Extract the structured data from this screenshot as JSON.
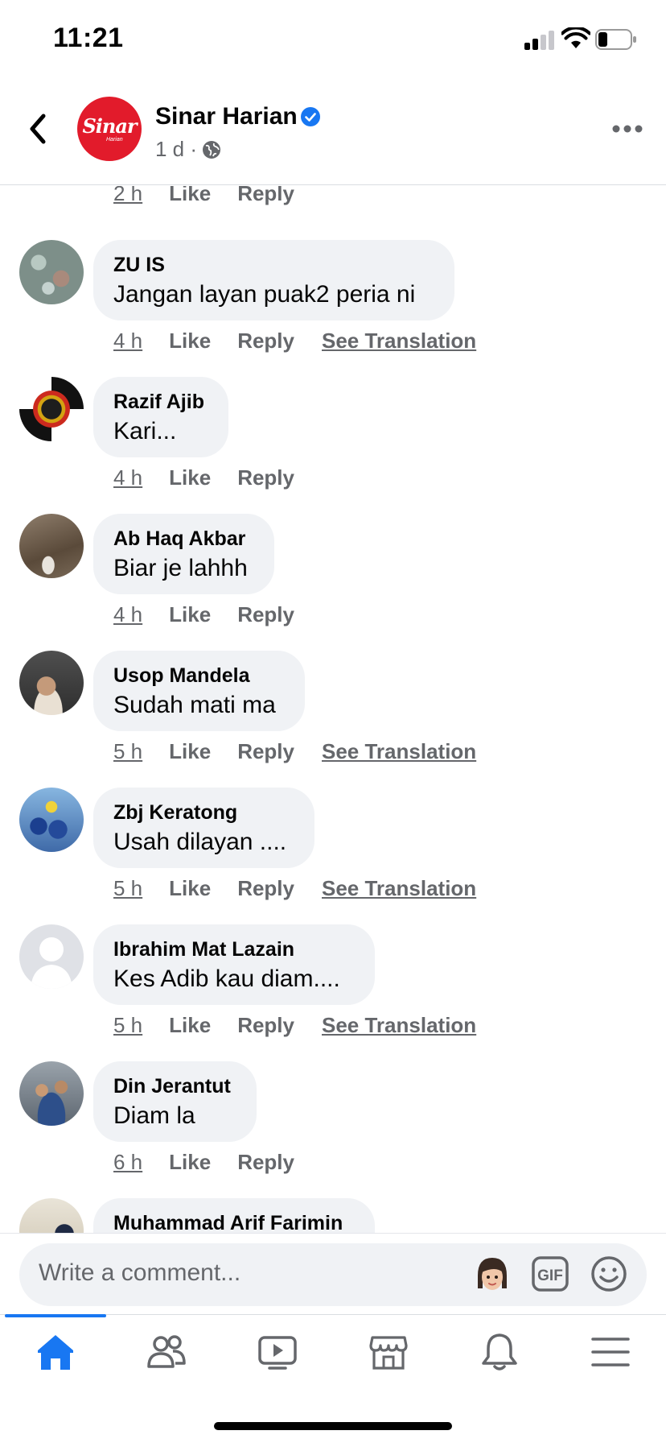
{
  "status_bar": {
    "time": "11:21"
  },
  "header": {
    "page_name": "Sinar Harian",
    "time_ago": "1 d ·",
    "logo_text": "Sinar",
    "logo_subtext": "Harian"
  },
  "top_partial_actions": {
    "time": "2 h",
    "like": "Like",
    "reply": "Reply"
  },
  "comments": [
    {
      "author": "ZU IS",
      "text": "Jangan layan puak2 peria ni",
      "time": "4 h",
      "like": "Like",
      "reply": "Reply",
      "translate": "See Translation"
    },
    {
      "author": "Razif Ajib",
      "text": "Kari...",
      "time": "4 h",
      "like": "Like",
      "reply": "Reply",
      "translate": ""
    },
    {
      "author": "Ab Haq Akbar",
      "text": "Biar je lahhh",
      "time": "4 h",
      "like": "Like",
      "reply": "Reply",
      "translate": ""
    },
    {
      "author": "Usop Mandela",
      "text": "Sudah mati ma",
      "time": "5 h",
      "like": "Like",
      "reply": "Reply",
      "translate": "See Translation"
    },
    {
      "author": "Zbj Keratong",
      "text": "Usah dilayan ....",
      "time": "5 h",
      "like": "Like",
      "reply": "Reply",
      "translate": "See Translation"
    },
    {
      "author": "Ibrahim Mat Lazain",
      "text": "Kes Adib kau diam....",
      "time": "5 h",
      "like": "Like",
      "reply": "Reply",
      "translate": "See Translation"
    },
    {
      "author": "Din Jerantut",
      "text": "Diam la",
      "time": "6 h",
      "like": "Like",
      "reply": "Reply",
      "translate": ""
    },
    {
      "author": "Muhammad Arif Farimin",
      "text": "",
      "time": "",
      "like": "",
      "reply": "",
      "translate": ""
    }
  ],
  "composer": {
    "placeholder": "Write a comment..."
  },
  "tab_bar": {
    "tabs": [
      "home-icon",
      "friends-icon",
      "watch-icon",
      "marketplace-icon",
      "notifications-icon",
      "menu-icon"
    ],
    "active_tab": "home-icon"
  },
  "colors": {
    "accent": "#1877f2",
    "bubble": "#f0f2f5",
    "secondary_text": "#65676b",
    "brand_red": "#e21b2b"
  }
}
